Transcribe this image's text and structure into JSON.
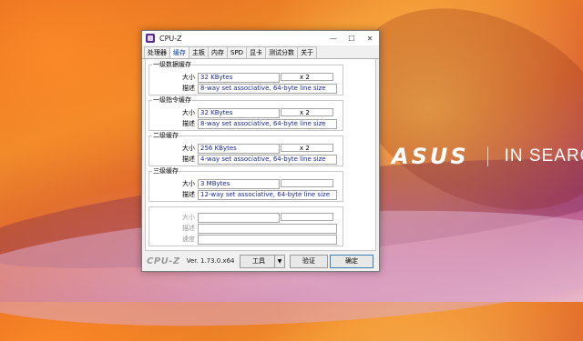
{
  "window": {
    "title": "CPU-Z",
    "controls": {
      "minimize": "—",
      "maximize": "☐",
      "close": "✕"
    }
  },
  "tabs": [
    "处理器",
    "缓存",
    "主板",
    "内存",
    "SPD",
    "显卡",
    "测试分数",
    "关于"
  ],
  "active_tab": "缓存",
  "labels": {
    "size": "大小",
    "desc": "描述",
    "speed": "速度"
  },
  "groups": {
    "l1d": {
      "title": "一级数据缓存",
      "size": "32 KBytes",
      "mult": "x 2",
      "desc": "8-way set associative, 64-byte line size"
    },
    "l1i": {
      "title": "一级指令缓存",
      "size": "32 KBytes",
      "mult": "x 2",
      "desc": "8-way set associative, 64-byte line size"
    },
    "l2": {
      "title": "二级缓存",
      "size": "256 KBytes",
      "mult": "x 2",
      "desc": "4-way set associative, 64-byte line size"
    },
    "l3": {
      "title": "三级缓存",
      "size": "3 MBytes",
      "mult": "",
      "desc": "12-way set associative, 64-byte line size"
    }
  },
  "footer": {
    "logo": "CPU-Z",
    "version": "Ver. 1.73.0.x64",
    "tools": "工具",
    "validate": "验证",
    "ok": "确定"
  },
  "wallpaper": {
    "brand": "ASUS",
    "slogan": "IN SEARCH"
  },
  "colors": {
    "active_tab": "#0033aa",
    "field_text": "#1a2a9a",
    "icon_purple": "#5b2b8c"
  }
}
